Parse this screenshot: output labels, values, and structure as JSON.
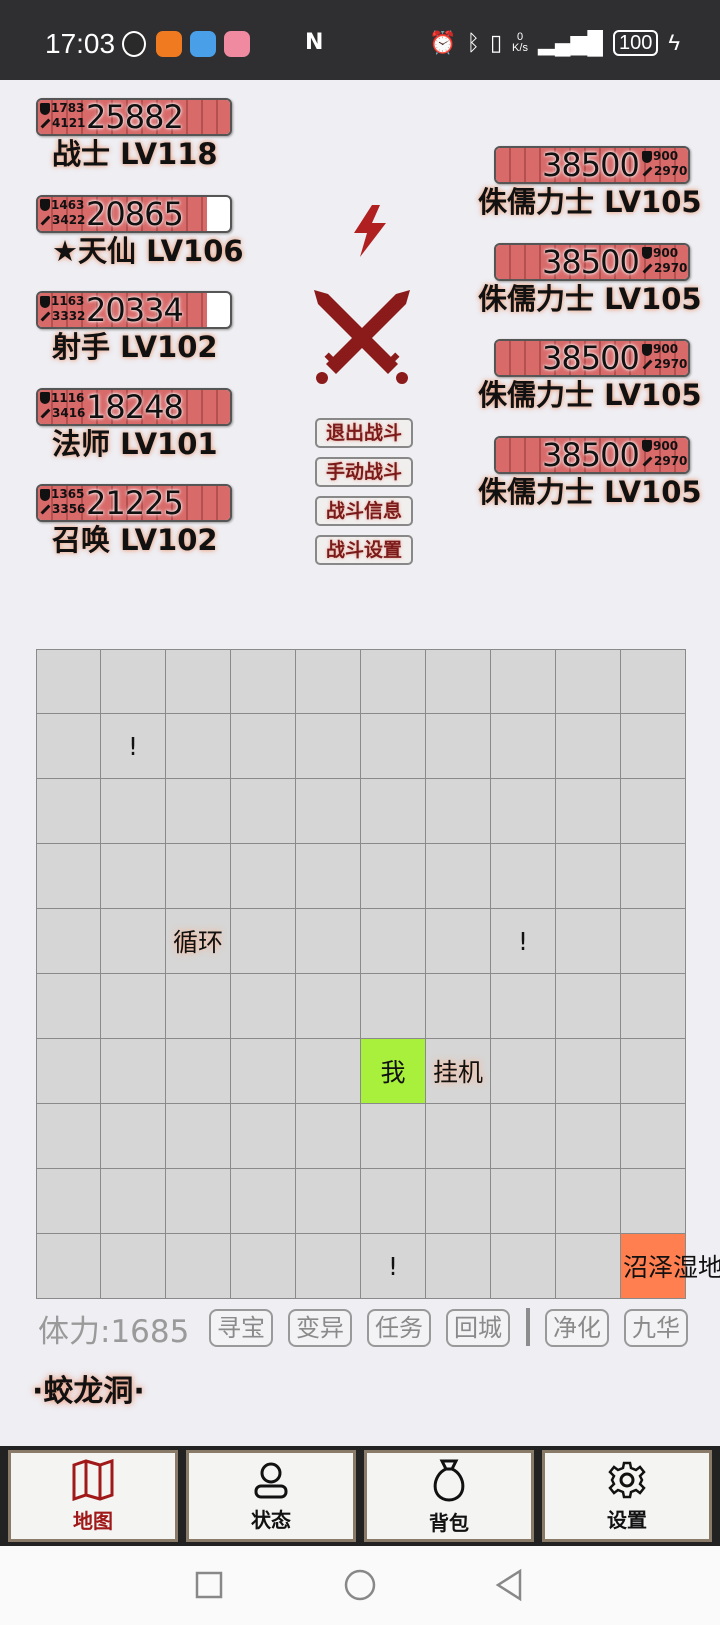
{
  "status_bar": {
    "time": "17:03",
    "net_speed_value": "0",
    "net_speed_unit": "K/s",
    "battery": "100",
    "app_icons": [
      "qq-icon",
      "app-orange-icon",
      "app-blue-icon",
      "app-pink-icon"
    ]
  },
  "party": [
    {
      "hp": "25882",
      "def": "1783",
      "atk": "4121",
      "name": "战士 LV118",
      "fill": 1.0
    },
    {
      "hp": "20865",
      "def": "1463",
      "atk": "3422",
      "name": "★天仙 LV106",
      "fill": 0.88
    },
    {
      "hp": "20334",
      "def": "1163",
      "atk": "3332",
      "name": "射手 LV102",
      "fill": 0.88
    },
    {
      "hp": "18248",
      "def": "1116",
      "atk": "3416",
      "name": "法师 LV101",
      "fill": 1.0
    },
    {
      "hp": "21225",
      "def": "1365",
      "atk": "3356",
      "name": "召唤 LV102",
      "fill": 1.0
    }
  ],
  "enemies": [
    {
      "hp": "38500",
      "def": "900",
      "atk": "2970",
      "name": "侏儒力士 LV105",
      "fill": 1.0
    },
    {
      "hp": "38500",
      "def": "900",
      "atk": "2970",
      "name": "侏儒力士 LV105",
      "fill": 1.0
    },
    {
      "hp": "38500",
      "def": "900",
      "atk": "2970",
      "name": "侏儒力士 LV105",
      "fill": 1.0
    },
    {
      "hp": "38500",
      "def": "900",
      "atk": "2970",
      "name": "侏儒力士 LV105",
      "fill": 1.0
    }
  ],
  "battle_commands": [
    "退出战斗",
    "手动战斗",
    "战斗信息",
    "战斗设置"
  ],
  "map_grid": {
    "rows": 10,
    "cols": 10,
    "cells": [
      {
        "row": 1,
        "col": 1,
        "text": "!"
      },
      {
        "row": 4,
        "col": 2,
        "text": "循环",
        "style": "glow"
      },
      {
        "row": 4,
        "col": 7,
        "text": "!"
      },
      {
        "row": 6,
        "col": 5,
        "text": "我",
        "style": "me"
      },
      {
        "row": 6,
        "col": 6,
        "text": "挂机",
        "style": "glow"
      },
      {
        "row": 9,
        "col": 5,
        "text": "!"
      },
      {
        "row": 9,
        "col": 9,
        "text": "沼泽湿地",
        "style": "swamp"
      }
    ]
  },
  "stamina": "体力:1685",
  "actions": [
    "寻宝",
    "变异",
    "任务",
    "回城",
    "净化",
    "九华"
  ],
  "location": "·蛟龙洞·",
  "tabs": [
    {
      "label": "地图",
      "icon": "map-icon",
      "active": true
    },
    {
      "label": "状态",
      "icon": "person-icon",
      "active": false
    },
    {
      "label": "背包",
      "icon": "bag-icon",
      "active": false
    },
    {
      "label": "设置",
      "icon": "gear-icon",
      "active": false
    }
  ],
  "colors": {
    "hp_fill": "#d86a6a",
    "accent_red": "#a01818",
    "player_cell": "#a8f03c",
    "swamp_cell": "#ff7f50"
  }
}
